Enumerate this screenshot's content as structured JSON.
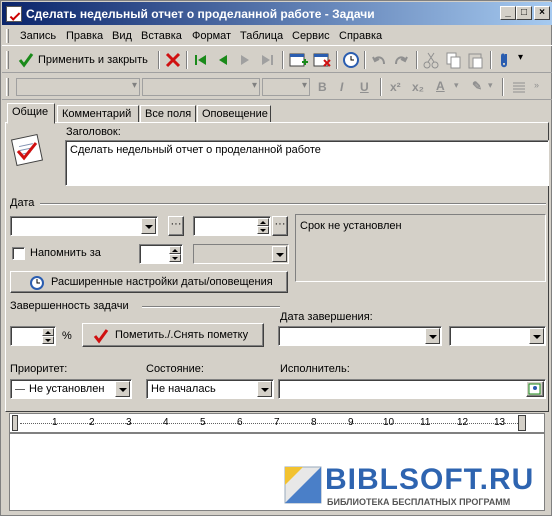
{
  "window": {
    "title": "Сделать недельный отчет о проделанной работе - Задачи"
  },
  "menu": [
    "Запись",
    "Правка",
    "Вид",
    "Вставка",
    "Формат",
    "Таблица",
    "Сервис",
    "Справка"
  ],
  "toolbar": {
    "apply_close": "Применить и закрыть"
  },
  "tabs": [
    "Общие",
    "Комментарий",
    "Все поля",
    "Оповещение"
  ],
  "general": {
    "heading_label": "Заголовок:",
    "heading_value": "Сделать недельный отчет о проделанной работе",
    "date_group": "Дата",
    "due_status": "Срок не установлен",
    "remind_label": "Напомнить за",
    "advanced_button": "Расширенные настройки даты/оповещения",
    "completion_group": "Завершенность задачи",
    "percent_sign": "%",
    "mark_button": "Пометить./.Снять пометку",
    "finish_date_label": "Дата завершения:",
    "priority_label": "Приоритет:",
    "priority_value": "Не установлен",
    "state_label": "Состояние:",
    "state_value": "Не началась",
    "executor_label": "Исполнитель:"
  },
  "ruler": {
    "marks": [
      "1",
      "2",
      "3",
      "4",
      "5",
      "6",
      "7",
      "8",
      "9",
      "10",
      "11",
      "12",
      "13"
    ]
  },
  "watermark": {
    "brand": "BIBLSOFT.RU",
    "tagline": "БИБЛИОТЕКА БЕСПЛАТНЫХ ПРОГРАММ"
  }
}
